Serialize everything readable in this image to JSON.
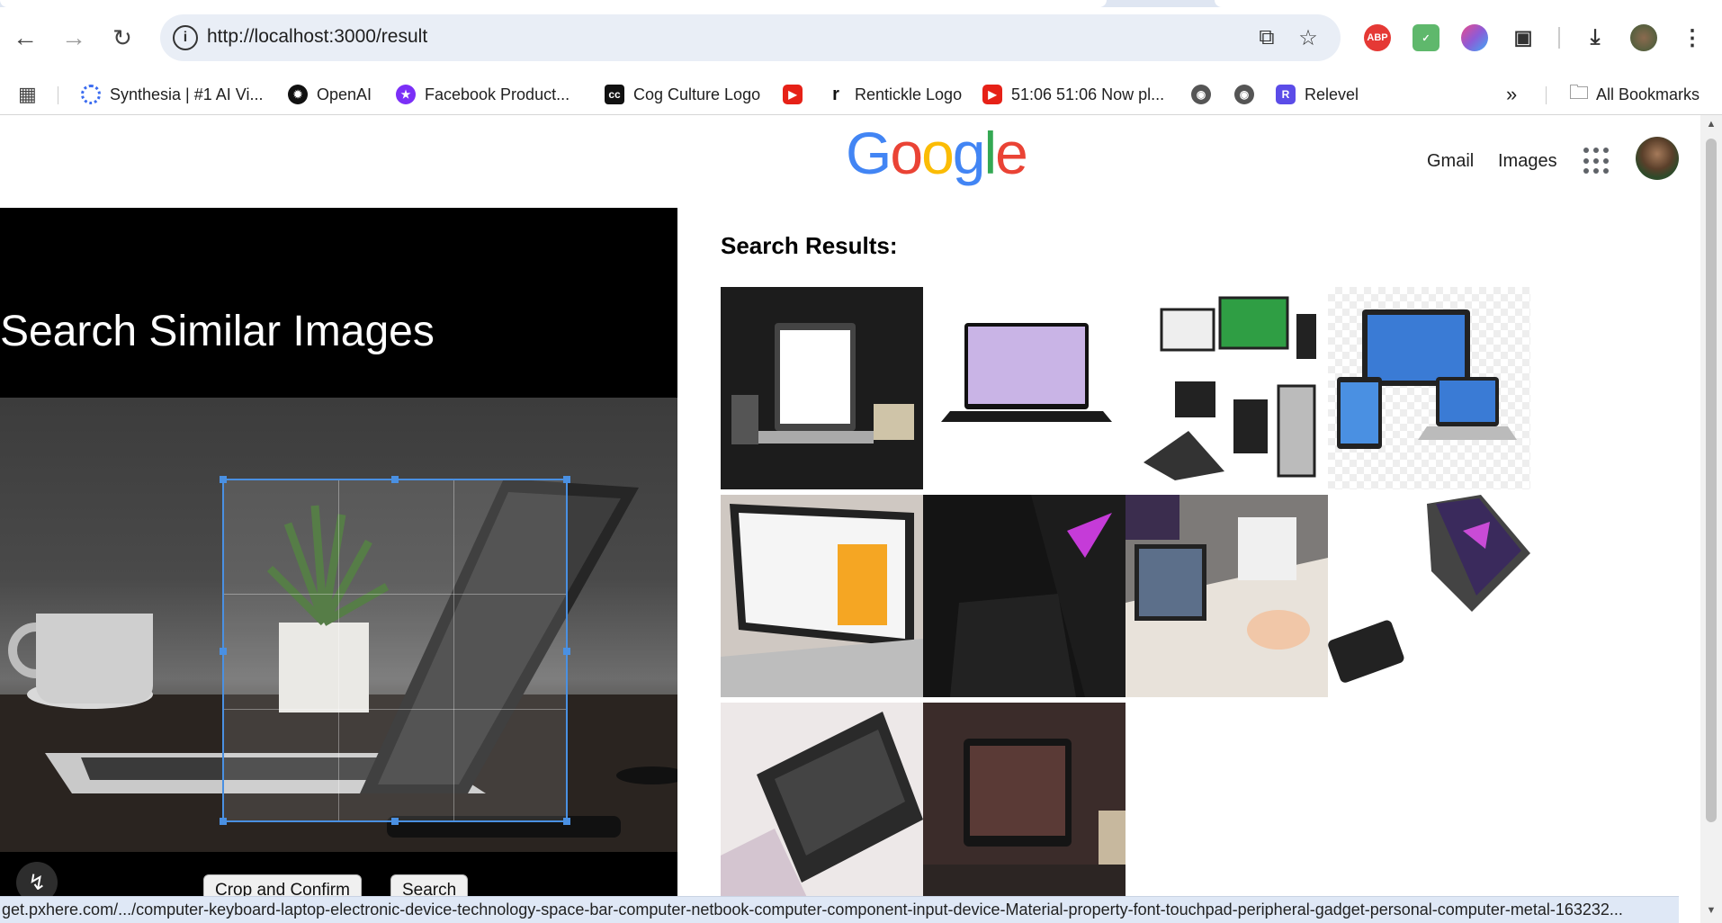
{
  "browser": {
    "url": "http://localhost:3000/result",
    "extensions": [
      "adblock-icon",
      "mail-ext-icon",
      "brain-ext-icon",
      "puzzle-icon"
    ],
    "bookmarks": [
      {
        "label": "Synthesia | #1 AI Vi...",
        "icon": "synthesia-icon"
      },
      {
        "label": "OpenAI",
        "icon": "openai-icon"
      },
      {
        "label": "Facebook Product...",
        "icon": "facebook-icon"
      },
      {
        "label": "Cog Culture Logo",
        "icon": "cc-icon"
      },
      {
        "label": "",
        "icon": "youtube-icon"
      },
      {
        "label": "Renticklе Logo",
        "icon": "r-icon"
      },
      {
        "label": "51:06 51:06 Now pl...",
        "icon": "youtube-icon"
      },
      {
        "label": "",
        "icon": "globe-icon"
      },
      {
        "label": "",
        "icon": "globe-icon"
      },
      {
        "label": "Relevel",
        "icon": "relevel-icon"
      }
    ],
    "all_bookmarks": "All Bookmarks",
    "status_url": "get.pxhere.com/.../computer-keyboard-laptop-electronic-device-technology-space-bar-computer-netbook-computer-component-input-device-Material-property-font-touchpad-peripheral-gadget-personal-computer-metal-163232..."
  },
  "header": {
    "logo": [
      "G",
      "o",
      "o",
      "g",
      "l",
      "e"
    ],
    "logo_colors": [
      "#4285F4",
      "#EA4335",
      "#FBBC05",
      "#4285F4",
      "#34A853",
      "#EA4335"
    ],
    "gmail": "Gmail",
    "images": "Images"
  },
  "left": {
    "title": "Search Similar Images",
    "crop_button": "Crop and Confirm",
    "search_button": "Search"
  },
  "results": {
    "title": "Search Results:"
  },
  "colors": {
    "accent": "#4a90e2",
    "bookmark_bar_border": "#d6d6d6"
  }
}
